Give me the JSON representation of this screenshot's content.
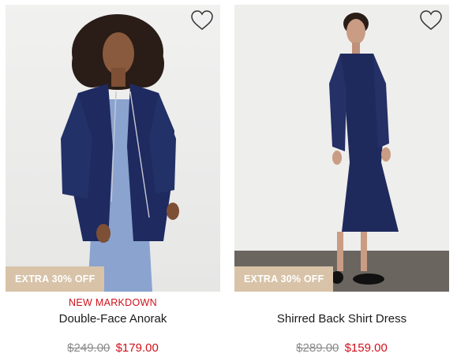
{
  "products": [
    {
      "tag": "NEW MARKDOWN",
      "name": "Double-Face Anorak",
      "original_price": "$249.00",
      "sale_price": "$179.00",
      "badge": "EXTRA 30% OFF",
      "image_alt": "Model wearing navy double-face anorak over light blue ribbed dress"
    },
    {
      "tag": "",
      "name": "Shirred Back Shirt Dress",
      "original_price": "$289.00",
      "sale_price": "$159.00",
      "badge": "EXTRA 30% OFF",
      "image_alt": "Model wearing navy shirred back shirt dress with black loafers"
    }
  ],
  "colors": {
    "badge_bg": "#d8c3a8",
    "sale_red": "#d0101b",
    "navy": "#1f2a5c"
  },
  "icons": {
    "wishlist": "heart-outline-icon"
  }
}
